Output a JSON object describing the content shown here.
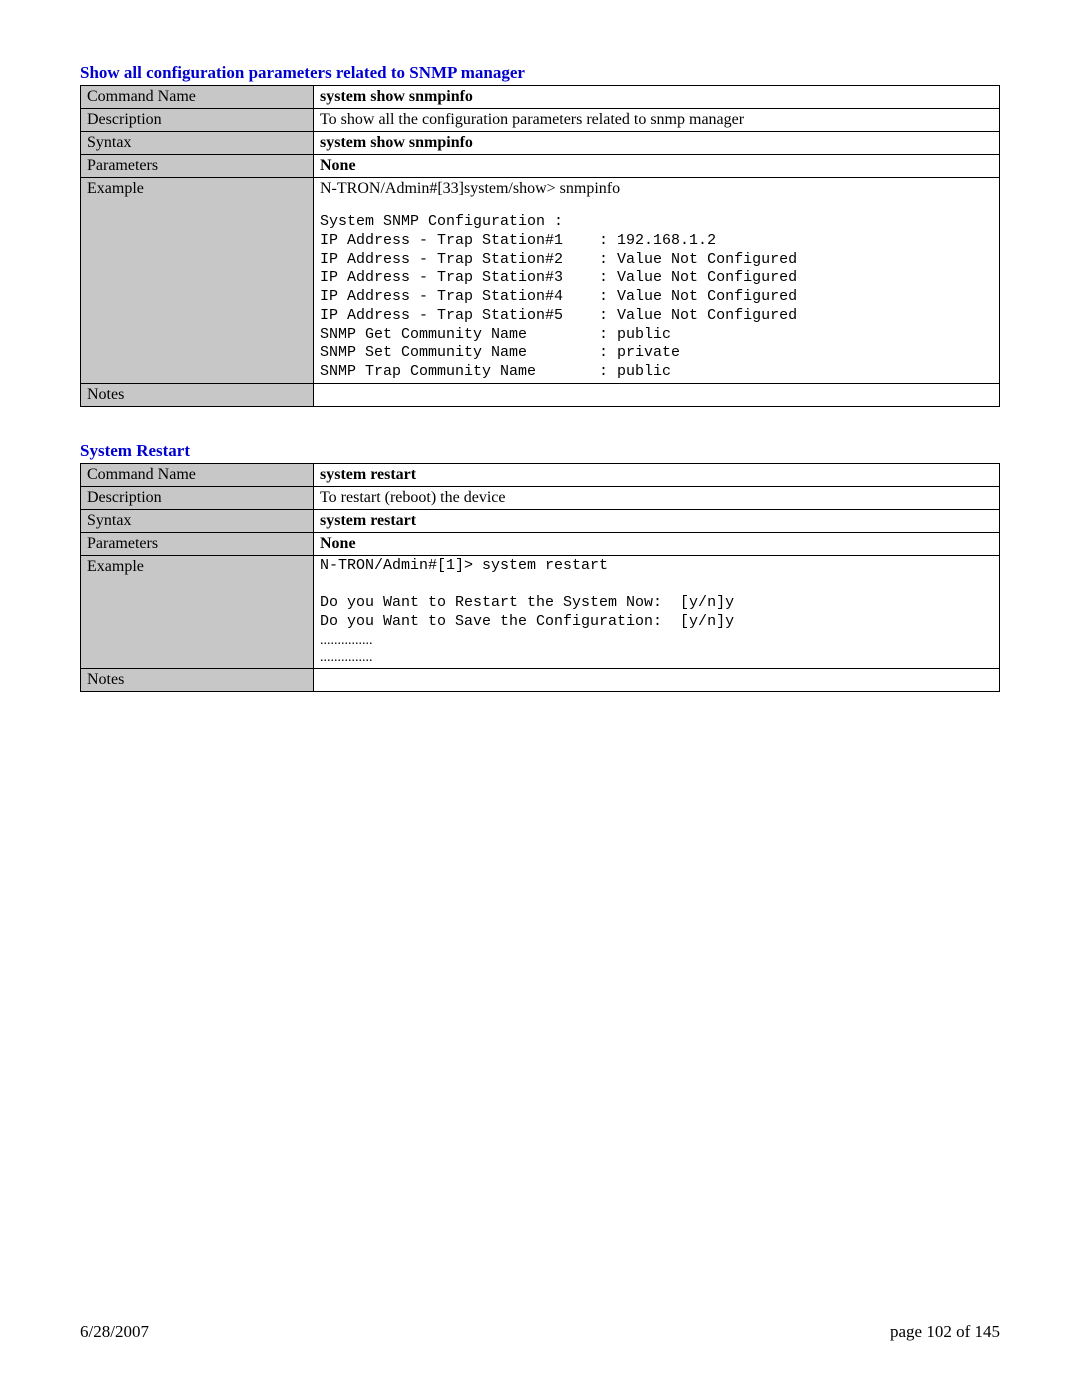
{
  "sections": [
    {
      "title": "Show all configuration parameters related to SNMP manager",
      "rows": {
        "commandNameLabel": "Command Name",
        "commandName": "system show snmpinfo",
        "descriptionLabel": "Description",
        "description": "To show all the configuration parameters related to snmp manager",
        "syntaxLabel": "Syntax",
        "syntax": "system show snmpinfo",
        "parametersLabel": "Parameters",
        "parameters": "None",
        "exampleLabel": "Example",
        "exampleIntro": "N-TRON/Admin#[33]system/show> snmpinfo",
        "exampleMono": "System SNMP Configuration :\nIP Address - Trap Station#1    : 192.168.1.2\nIP Address - Trap Station#2    : Value Not Configured\nIP Address - Trap Station#3    : Value Not Configured\nIP Address - Trap Station#4    : Value Not Configured\nIP Address - Trap Station#5    : Value Not Configured\nSNMP Get Community Name        : public\nSNMP Set Community Name        : private\nSNMP Trap Community Name       : public",
        "notesLabel": "Notes",
        "notes": ""
      }
    },
    {
      "title": "System Restart",
      "rows": {
        "commandNameLabel": "Command Name",
        "commandName": "system  restart",
        "descriptionLabel": "Description",
        "description": "To restart (reboot) the device",
        "syntaxLabel": "Syntax",
        "syntax": "system restart",
        "parametersLabel": "Parameters",
        "parameters": "None",
        "exampleLabel": "Example",
        "exampleMono": "N-TRON/Admin#[1]> system restart\n\nDo you Want to Restart the System Now:  [y/n]y\nDo you Want to Save the Configuration:  [y/n]y",
        "exampleDots1": "...............",
        "exampleDots2": "...............",
        "notesLabel": "Notes",
        "notes": ""
      }
    }
  ],
  "footer": {
    "date": "6/28/2007",
    "page": "page 102 of 145"
  }
}
